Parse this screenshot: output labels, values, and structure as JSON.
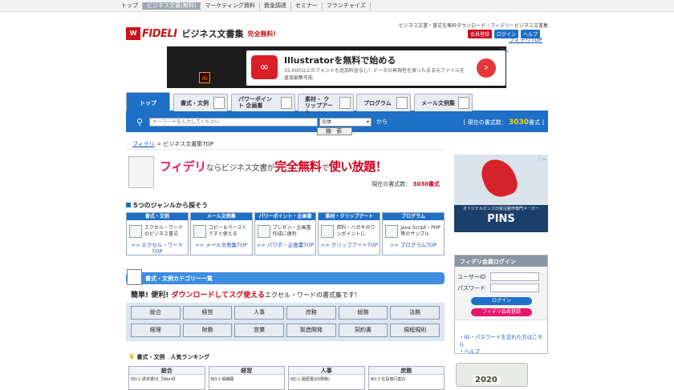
{
  "topnav": [
    "トップ",
    "ビジネス文書(無料)",
    "マーケティング資料",
    "資金調達",
    "セミナー",
    "フランチャイズ"
  ],
  "header": {
    "logo_mark": "W",
    "logo_brand": "FIDELI",
    "logo_sub": "ビジネス文書集",
    "logo_free": "完全無料!",
    "tagline": "ビジネス文書・書式を無料ダウンロード｜フィデリ・ビジネス文書集",
    "register": "会員登録",
    "login": "ログイン",
    "help": "ヘルプ",
    "top_link": "フィデリTOP"
  },
  "ad": {
    "title": "Illustratorを無料で始める",
    "sub": "15,000以上のフォントも追加料金なし！データの再現性を保ったまま元ファイルを直接編集可能",
    "adchoices": "ⓘ✕"
  },
  "tabs": [
    "トップ",
    "書式・文例",
    "パワーポイント 企画書",
    "素材・ クリップアート",
    "プログラム",
    "メール文例集"
  ],
  "search": {
    "placeholder": "キーワードを入力してください",
    "select": "全体",
    "kara": "から",
    "button": "検 索",
    "count_label": "[ 現在の書式数：",
    "count": "3030",
    "count_unit": "書式 ]"
  },
  "breadcrumb": {
    "home": "フィデリ",
    "current": "> ビジネス文書集TOP"
  },
  "hero": {
    "a": "フィデリ",
    "b": "ならビジネス文書が",
    "c": "完全無料",
    "d": "で",
    "e": "使い放題！",
    "count_label": "現在の書式数：",
    "count": "3030書式"
  },
  "genres_title": "5つのジャンルから探そう",
  "genres": [
    {
      "head": "書式・文例",
      "text": "エクセル・ワードのビジネス書式",
      "link": ">> エクセル・ワードTOP"
    },
    {
      "head": "メール文例集",
      "text": "コピー＆ペーストですぐ使える",
      "link": ">> メール文例集TOP"
    },
    {
      "head": "パワーポイント・企画書",
      "text": "プレゼン・企画書作成に便利",
      "link": ">> パワポ・企画書TOP"
    },
    {
      "head": "素材・クリップアート",
      "text": "資料・ハガキのワンポイントに",
      "link": ">> クリップアートTOP"
    },
    {
      "head": "プログラム",
      "text": "Java Script・PHP等のサンプル",
      "link": ">> プログラムTOP"
    }
  ],
  "category": {
    "title": "書式・文例カテゴリー一覧",
    "lead_a": "簡単! 便利! ",
    "lead_b": "ダウンロードしてスグ使える",
    "lead_c": "エクセル・ワードの書式集です!",
    "items": [
      "総合",
      "経営",
      "人事",
      "庶務",
      "総務",
      "法務",
      "経理",
      "財務",
      "営業",
      "製造開発",
      "契約書",
      "規程規則"
    ]
  },
  "ranking": {
    "title": "書式・文例　人気ランキング",
    "cols": [
      {
        "head": "総合",
        "item": "NO.1 請求書01【Word】"
      },
      {
        "head": "経営",
        "item": "NO.1 組織図"
      },
      {
        "head": "人事",
        "item": "NO.1 履歴書(JIS規格)"
      },
      {
        "head": "庶務",
        "item": "NO.1 社員旅行案内"
      }
    ]
  },
  "sidead": {
    "line": "オリジナルピンズの受注製作専門メーカー",
    "brand": "PINS",
    "adc": "ⓘ✕"
  },
  "loginbox": {
    "title": "フィデリ会員ログイン",
    "user": "ユーザーID",
    "pass": "パスワード",
    "login": "ログイン",
    "register": "フィデリ会員登録",
    "forgot": "・ID・パスワードを忘れた方はこちら",
    "help": "・ヘルプ"
  },
  "calendar": {
    "year": "2020"
  },
  "colors": {
    "accent": "#1e6fc6",
    "brand_red": "#c8161d",
    "pink": "#e8156b"
  }
}
